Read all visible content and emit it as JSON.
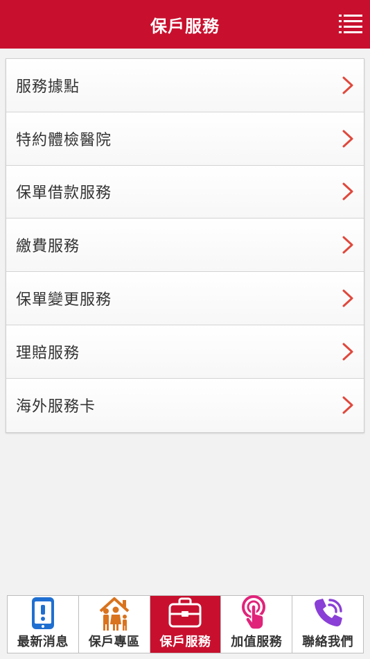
{
  "header": {
    "title": "保戶服務",
    "menu_icon": "list-menu-icon"
  },
  "list": {
    "items": [
      {
        "label": "服務據點"
      },
      {
        "label": "特約體檢醫院"
      },
      {
        "label": "保單借款服務"
      },
      {
        "label": "繳費服務"
      },
      {
        "label": "保單變更服務"
      },
      {
        "label": "理賠服務"
      },
      {
        "label": "海外服務卡"
      }
    ],
    "chevron_color": "#e0483c"
  },
  "tabbar": {
    "tabs": [
      {
        "label": "最新消息",
        "icon": "phone-alert-icon",
        "active": false
      },
      {
        "label": "保戶專區",
        "icon": "family-home-icon",
        "active": false
      },
      {
        "label": "保戶服務",
        "icon": "briefcase-icon",
        "active": true
      },
      {
        "label": "加值服務",
        "icon": "tap-finger-icon",
        "active": false
      },
      {
        "label": "聯絡我們",
        "icon": "phone-call-icon",
        "active": false
      }
    ]
  },
  "colors": {
    "brand": "#c8102e",
    "background": "#f2f2f2"
  }
}
